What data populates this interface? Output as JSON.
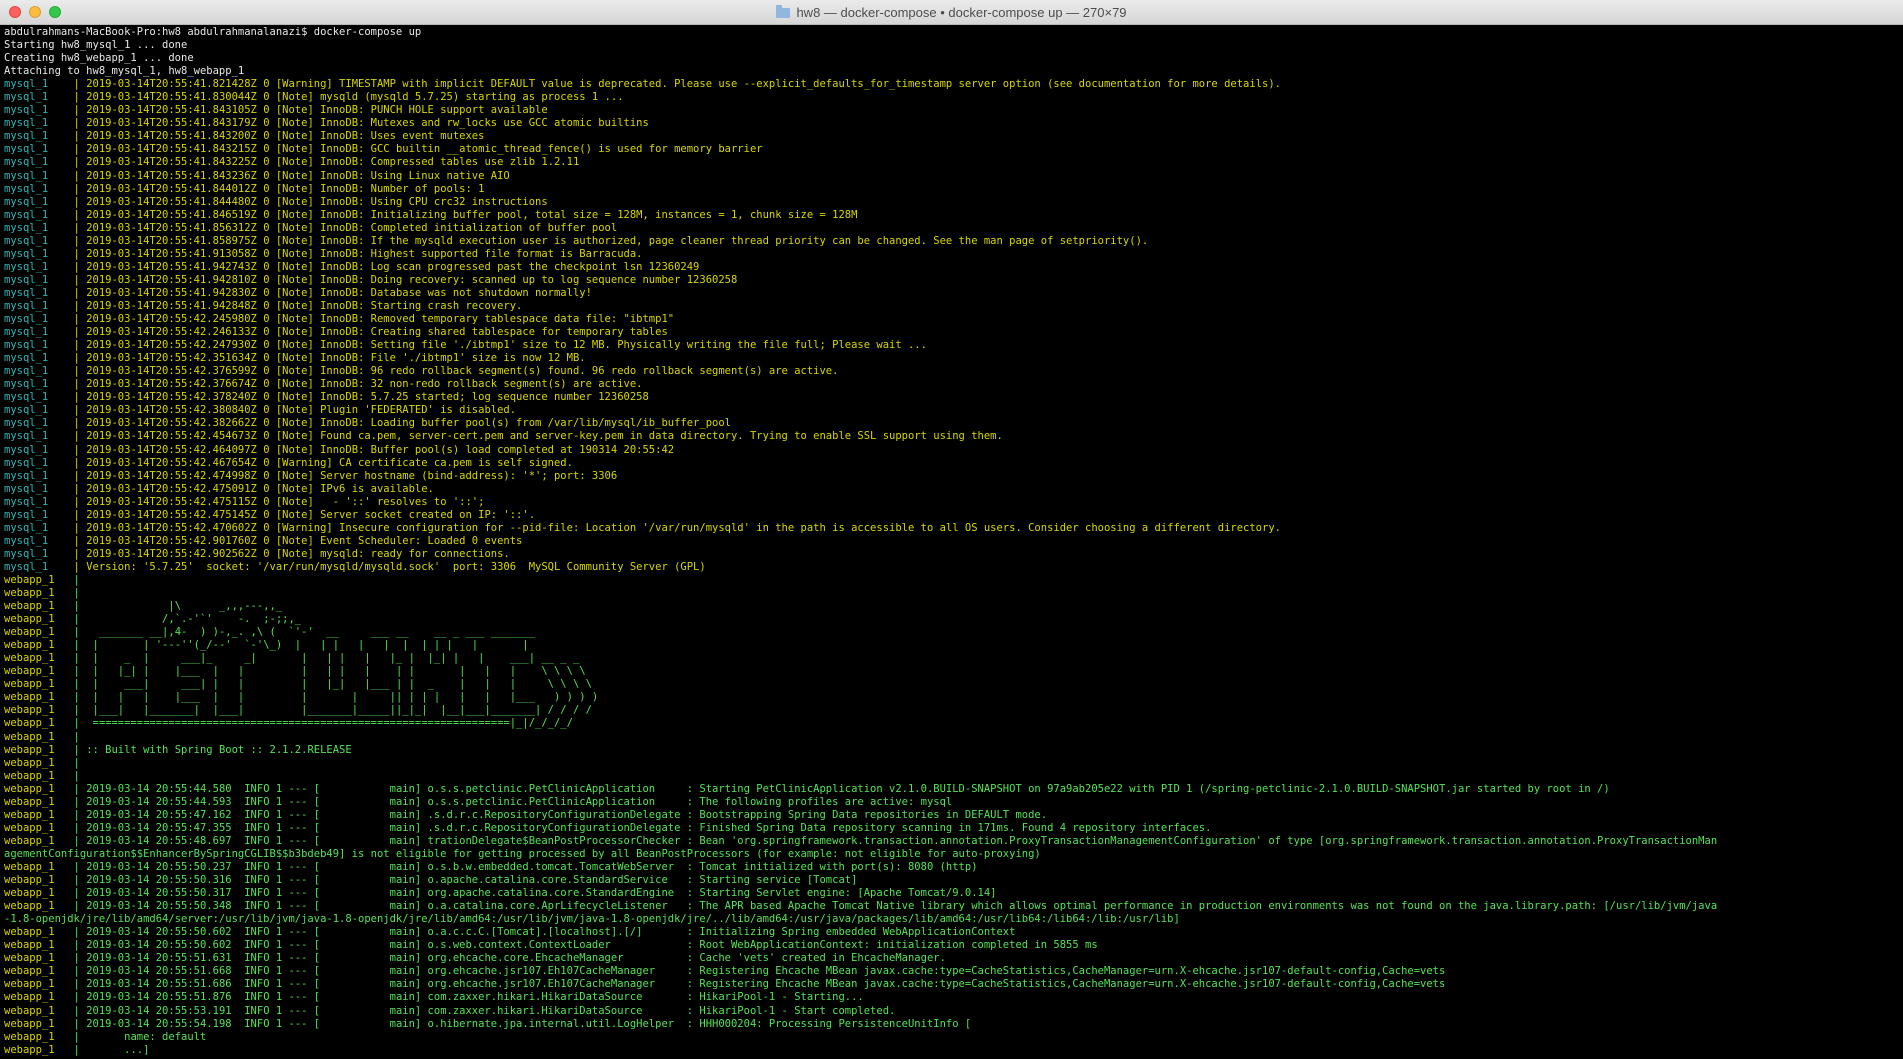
{
  "window": {
    "title": "hw8 — docker-compose • docker-compose up — 270×79"
  },
  "colors": {
    "background": "#000000",
    "mysql_prefix": "#2fb8b8",
    "webapp_prefix": "#d7d700",
    "mysql_text": "#d7d700",
    "webapp_text": "#54e354"
  },
  "terminal": {
    "lines": [
      {
        "p": "",
        "t": "abdulrahmans-MacBook-Pro:hw8 abdulrahmanalanazi$ docker-compose up"
      },
      {
        "p": "",
        "t": "Starting hw8_mysql_1 ... done"
      },
      {
        "p": "",
        "t": "Creating hw8_webapp_1 ... done"
      },
      {
        "p": "",
        "t": "Attaching to hw8_mysql_1, hw8_webapp_1"
      },
      {
        "p": "mysql_1 ",
        "t": "| 2019-03-14T20:55:41.821428Z 0 [Warning] TIMESTAMP with implicit DEFAULT value is deprecated. Please use --explicit_defaults_for_timestamp server option (see documentation for more details)."
      },
      {
        "p": "mysql_1 ",
        "t": "| 2019-03-14T20:55:41.830044Z 0 [Note] mysqld (mysqld 5.7.25) starting as process 1 ..."
      },
      {
        "p": "mysql_1 ",
        "t": "| 2019-03-14T20:55:41.843105Z 0 [Note] InnoDB: PUNCH HOLE support available"
      },
      {
        "p": "mysql_1 ",
        "t": "| 2019-03-14T20:55:41.843179Z 0 [Note] InnoDB: Mutexes and rw_locks use GCC atomic builtins"
      },
      {
        "p": "mysql_1 ",
        "t": "| 2019-03-14T20:55:41.843200Z 0 [Note] InnoDB: Uses event mutexes"
      },
      {
        "p": "mysql_1 ",
        "t": "| 2019-03-14T20:55:41.843215Z 0 [Note] InnoDB: GCC builtin __atomic_thread_fence() is used for memory barrier"
      },
      {
        "p": "mysql_1 ",
        "t": "| 2019-03-14T20:55:41.843225Z 0 [Note] InnoDB: Compressed tables use zlib 1.2.11"
      },
      {
        "p": "mysql_1 ",
        "t": "| 2019-03-14T20:55:41.843236Z 0 [Note] InnoDB: Using Linux native AIO"
      },
      {
        "p": "mysql_1 ",
        "t": "| 2019-03-14T20:55:41.844012Z 0 [Note] InnoDB: Number of pools: 1"
      },
      {
        "p": "mysql_1 ",
        "t": "| 2019-03-14T20:55:41.844480Z 0 [Note] InnoDB: Using CPU crc32 instructions"
      },
      {
        "p": "mysql_1 ",
        "t": "| 2019-03-14T20:55:41.846519Z 0 [Note] InnoDB: Initializing buffer pool, total size = 128M, instances = 1, chunk size = 128M"
      },
      {
        "p": "mysql_1 ",
        "t": "| 2019-03-14T20:55:41.856312Z 0 [Note] InnoDB: Completed initialization of buffer pool"
      },
      {
        "p": "mysql_1 ",
        "t": "| 2019-03-14T20:55:41.858975Z 0 [Note] InnoDB: If the mysqld execution user is authorized, page cleaner thread priority can be changed. See the man page of setpriority()."
      },
      {
        "p": "mysql_1 ",
        "t": "| 2019-03-14T20:55:41.913058Z 0 [Note] InnoDB: Highest supported file format is Barracuda."
      },
      {
        "p": "mysql_1 ",
        "t": "| 2019-03-14T20:55:41.942743Z 0 [Note] InnoDB: Log scan progressed past the checkpoint lsn 12360249"
      },
      {
        "p": "mysql_1 ",
        "t": "| 2019-03-14T20:55:41.942810Z 0 [Note] InnoDB: Doing recovery: scanned up to log sequence number 12360258"
      },
      {
        "p": "mysql_1 ",
        "t": "| 2019-03-14T20:55:41.942830Z 0 [Note] InnoDB: Database was not shutdown normally!"
      },
      {
        "p": "mysql_1 ",
        "t": "| 2019-03-14T20:55:41.942848Z 0 [Note] InnoDB: Starting crash recovery."
      },
      {
        "p": "mysql_1 ",
        "t": "| 2019-03-14T20:55:42.245980Z 0 [Note] InnoDB: Removed temporary tablespace data file: \"ibtmp1\""
      },
      {
        "p": "mysql_1 ",
        "t": "| 2019-03-14T20:55:42.246133Z 0 [Note] InnoDB: Creating shared tablespace for temporary tables"
      },
      {
        "p": "mysql_1 ",
        "t": "| 2019-03-14T20:55:42.247930Z 0 [Note] InnoDB: Setting file './ibtmp1' size to 12 MB. Physically writing the file full; Please wait ..."
      },
      {
        "p": "mysql_1 ",
        "t": "| 2019-03-14T20:55:42.351634Z 0 [Note] InnoDB: File './ibtmp1' size is now 12 MB."
      },
      {
        "p": "mysql_1 ",
        "t": "| 2019-03-14T20:55:42.376599Z 0 [Note] InnoDB: 96 redo rollback segment(s) found. 96 redo rollback segment(s) are active."
      },
      {
        "p": "mysql_1 ",
        "t": "| 2019-03-14T20:55:42.376674Z 0 [Note] InnoDB: 32 non-redo rollback segment(s) are active."
      },
      {
        "p": "mysql_1 ",
        "t": "| 2019-03-14T20:55:42.378240Z 0 [Note] InnoDB: 5.7.25 started; log sequence number 12360258"
      },
      {
        "p": "mysql_1 ",
        "t": "| 2019-03-14T20:55:42.380840Z 0 [Note] Plugin 'FEDERATED' is disabled."
      },
      {
        "p": "mysql_1 ",
        "t": "| 2019-03-14T20:55:42.382662Z 0 [Note] InnoDB: Loading buffer pool(s) from /var/lib/mysql/ib_buffer_pool"
      },
      {
        "p": "mysql_1 ",
        "t": "| 2019-03-14T20:55:42.454673Z 0 [Note] Found ca.pem, server-cert.pem and server-key.pem in data directory. Trying to enable SSL support using them."
      },
      {
        "p": "mysql_1 ",
        "t": "| 2019-03-14T20:55:42.464097Z 0 [Note] InnoDB: Buffer pool(s) load completed at 190314 20:55:42"
      },
      {
        "p": "mysql_1 ",
        "t": "| 2019-03-14T20:55:42.467654Z 0 [Warning] CA certificate ca.pem is self signed."
      },
      {
        "p": "mysql_1 ",
        "t": "| 2019-03-14T20:55:42.474998Z 0 [Note] Server hostname (bind-address): '*'; port: 3306"
      },
      {
        "p": "mysql_1 ",
        "t": "| 2019-03-14T20:55:42.475091Z 0 [Note] IPv6 is available."
      },
      {
        "p": "mysql_1 ",
        "t": "| 2019-03-14T20:55:42.475115Z 0 [Note]   - '::' resolves to '::';"
      },
      {
        "p": "mysql_1 ",
        "t": "| 2019-03-14T20:55:42.475145Z 0 [Note] Server socket created on IP: '::'."
      },
      {
        "p": "mysql_1 ",
        "t": "| 2019-03-14T20:55:42.470602Z 0 [Warning] Insecure configuration for --pid-file: Location '/var/run/mysqld' in the path is accessible to all OS users. Consider choosing a different directory."
      },
      {
        "p": "mysql_1 ",
        "t": "| 2019-03-14T20:55:42.901760Z 0 [Note] Event Scheduler: Loaded 0 events"
      },
      {
        "p": "mysql_1 ",
        "t": "| 2019-03-14T20:55:42.902562Z 0 [Note] mysqld: ready for connections."
      },
      {
        "p": "mysql_1 ",
        "t": "| Version: '5.7.25'  socket: '/var/run/mysqld/mysqld.sock'  port: 3306  MySQL Community Server (GPL)"
      },
      {
        "p": "webapp_1",
        "t": "|"
      },
      {
        "p": "webapp_1",
        "t": "|"
      },
      {
        "p": "webapp_1",
        "t": "|              |\\      _,,,---,,_"
      },
      {
        "p": "webapp_1",
        "t": "|             /,`.-'`'    -.  ;-;;,_"
      },
      {
        "p": "webapp_1",
        "t": "|   _______ __|,4-  ) )-,_. ,\\ (  `'-'  __     ___ __    __ _ ___ _______"
      },
      {
        "p": "webapp_1",
        "t": "|  |       | '---''(_/--'  `-'\\_)  |   | |   |   |  |  | | |   |       |"
      },
      {
        "p": "webapp_1",
        "t": "|  |    _  |     ___|_     _|       |   | |   |   |_ |  |_| |   |    ___| __ _ _"
      },
      {
        "p": "webapp_1",
        "t": "|  |   |_| |    |___  |   |         |   | |   |    | |       |   |   |    \\ \\ \\ \\"
      },
      {
        "p": "webapp_1",
        "t": "|  |    ___|     ___| |   |         |   |_|   |___ | |  _    |   |   |     \\ \\ \\ \\"
      },
      {
        "p": "webapp_1",
        "t": "|  |   |   |    |___  |   |         |       |     || | | |   |   |   |___   ) ) ) )"
      },
      {
        "p": "webapp_1",
        "t": "|  |___|   |_______|  |___|         |_______|_____||_|_|  |__|___|_______| / / / /"
      },
      {
        "p": "webapp_1",
        "t": "|  ==================================================================|_|/_/_/_/"
      },
      {
        "p": "webapp_1",
        "t": "|"
      },
      {
        "p": "webapp_1",
        "t": "| :: Built with Spring Boot :: 2.1.2.RELEASE"
      },
      {
        "p": "webapp_1",
        "t": "|"
      },
      {
        "p": "webapp_1",
        "t": "|"
      },
      {
        "p": "webapp_1",
        "t": "| 2019-03-14 20:55:44.580  INFO 1 --- [           main] o.s.s.petclinic.PetClinicApplication     : Starting PetClinicApplication v2.1.0.BUILD-SNAPSHOT on 97a9ab205e22 with PID 1 (/spring-petclinic-2.1.0.BUILD-SNAPSHOT.jar started by root in /)"
      },
      {
        "p": "webapp_1",
        "t": "| 2019-03-14 20:55:44.593  INFO 1 --- [           main] o.s.s.petclinic.PetClinicApplication     : The following profiles are active: mysql"
      },
      {
        "p": "webapp_1",
        "t": "| 2019-03-14 20:55:47.162  INFO 1 --- [           main] .s.d.r.c.RepositoryConfigurationDelegate : Bootstrapping Spring Data repositories in DEFAULT mode."
      },
      {
        "p": "webapp_1",
        "t": "| 2019-03-14 20:55:47.355  INFO 1 --- [           main] .s.d.r.c.RepositoryConfigurationDelegate : Finished Spring Data repository scanning in 171ms. Found 4 repository interfaces."
      },
      {
        "p": "webapp_1",
        "t": "| 2019-03-14 20:55:48.697  INFO 1 --- [           main] trationDelegate$BeanPostProcessorChecker : Bean 'org.springframework.transaction.annotation.ProxyTransactionManagementConfiguration' of type [org.springframework.transaction.annotation.ProxyTransactionMan"
      },
      {
        "p": "",
        "t": "agementConfiguration$$EnhancerBySpringCGLIB$$b3bdeb49] is not eligible for getting processed by all BeanPostProcessors (for example: not eligible for auto-proxying)",
        "c": "webapp"
      },
      {
        "p": "webapp_1",
        "t": "| 2019-03-14 20:55:50.237  INFO 1 --- [           main] o.s.b.w.embedded.tomcat.TomcatWebServer  : Tomcat initialized with port(s): 8080 (http)"
      },
      {
        "p": "webapp_1",
        "t": "| 2019-03-14 20:55:50.316  INFO 1 --- [           main] o.apache.catalina.core.StandardService   : Starting service [Tomcat]"
      },
      {
        "p": "webapp_1",
        "t": "| 2019-03-14 20:55:50.317  INFO 1 --- [           main] org.apache.catalina.core.StandardEngine  : Starting Servlet engine: [Apache Tomcat/9.0.14]"
      },
      {
        "p": "webapp_1",
        "t": "| 2019-03-14 20:55:50.348  INFO 1 --- [           main] o.a.catalina.core.AprLifecycleListener   : The APR based Apache Tomcat Native library which allows optimal performance in production environments was not found on the java.library.path: [/usr/lib/jvm/java"
      },
      {
        "p": "",
        "t": "-1.8-openjdk/jre/lib/amd64/server:/usr/lib/jvm/java-1.8-openjdk/jre/lib/amd64:/usr/lib/jvm/java-1.8-openjdk/jre/../lib/amd64:/usr/java/packages/lib/amd64:/usr/lib64:/lib64:/lib:/usr/lib]",
        "c": "webapp"
      },
      {
        "p": "webapp_1",
        "t": "| 2019-03-14 20:55:50.602  INFO 1 --- [           main] o.a.c.c.C.[Tomcat].[localhost].[/]       : Initializing Spring embedded WebApplicationContext"
      },
      {
        "p": "webapp_1",
        "t": "| 2019-03-14 20:55:50.602  INFO 1 --- [           main] o.s.web.context.ContextLoader            : Root WebApplicationContext: initialization completed in 5855 ms"
      },
      {
        "p": "webapp_1",
        "t": "| 2019-03-14 20:55:51.631  INFO 1 --- [           main] org.ehcache.core.EhcacheManager          : Cache 'vets' created in EhcacheManager."
      },
      {
        "p": "webapp_1",
        "t": "| 2019-03-14 20:55:51.668  INFO 1 --- [           main] org.ehcache.jsr107.Eh107CacheManager     : Registering Ehcache MBean javax.cache:type=CacheStatistics,CacheManager=urn.X-ehcache.jsr107-default-config,Cache=vets"
      },
      {
        "p": "webapp_1",
        "t": "| 2019-03-14 20:55:51.686  INFO 1 --- [           main] org.ehcache.jsr107.Eh107CacheManager     : Registering Ehcache MBean javax.cache:type=CacheStatistics,CacheManager=urn.X-ehcache.jsr107-default-config,Cache=vets"
      },
      {
        "p": "webapp_1",
        "t": "| 2019-03-14 20:55:51.876  INFO 1 --- [           main] com.zaxxer.hikari.HikariDataSource       : HikariPool-1 - Starting..."
      },
      {
        "p": "webapp_1",
        "t": "| 2019-03-14 20:55:53.191  INFO 1 --- [           main] com.zaxxer.hikari.HikariDataSource       : HikariPool-1 - Start completed."
      },
      {
        "p": "webapp_1",
        "t": "| 2019-03-14 20:55:54.198  INFO 1 --- [           main] o.hibernate.jpa.internal.util.LogHelper  : HHH000204: Processing PersistenceUnitInfo ["
      },
      {
        "p": "webapp_1",
        "t": "|       name: default"
      },
      {
        "p": "webapp_1",
        "t": "|       ...]"
      }
    ]
  }
}
